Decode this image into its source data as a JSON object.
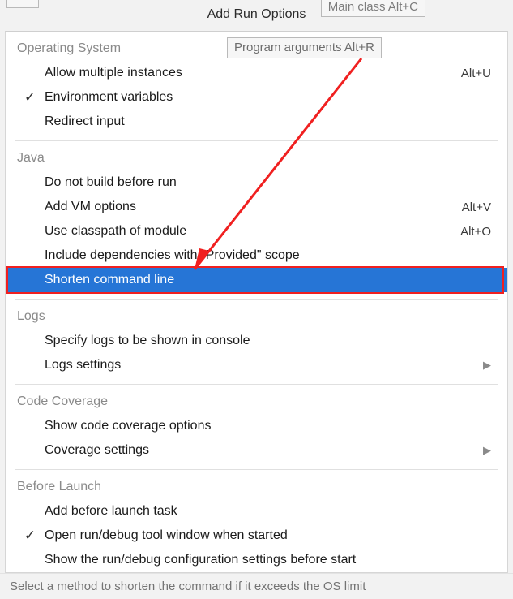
{
  "title": "Add Run Options",
  "tooltips": {
    "main_class": "Main class Alt+C",
    "program_args": "Program arguments Alt+R"
  },
  "sections": {
    "os": {
      "header": "Operating System",
      "items": {
        "allow_multiple": {
          "label": "Allow multiple instances",
          "shortcut": "Alt+U"
        },
        "env_vars": {
          "label": "Environment variables"
        },
        "redirect_input": {
          "label": "Redirect input"
        }
      }
    },
    "java": {
      "header": "Java",
      "items": {
        "no_build": {
          "label": "Do not build before run"
        },
        "vm_options": {
          "label": "Add VM options",
          "shortcut": "Alt+V"
        },
        "classpath": {
          "label": "Use classpath of module",
          "shortcut": "Alt+O"
        },
        "provided": {
          "label": "Include dependencies with \"Provided\" scope"
        },
        "shorten_cli": {
          "label": "Shorten command line"
        }
      }
    },
    "logs": {
      "header": "Logs",
      "items": {
        "specify_logs": {
          "label": "Specify logs to be shown in console"
        },
        "logs_settings": {
          "label": "Logs settings"
        }
      }
    },
    "coverage": {
      "header": "Code Coverage",
      "items": {
        "show_cc": {
          "label": "Show code coverage options"
        },
        "cc_settings": {
          "label": "Coverage settings"
        }
      }
    },
    "before": {
      "header": "Before Launch",
      "items": {
        "add_task": {
          "label": "Add before launch task"
        },
        "open_tool": {
          "label": "Open run/debug tool window when started"
        },
        "show_cfg": {
          "label": "Show the run/debug configuration settings before start"
        }
      }
    }
  },
  "status": "Select a method to shorten the command if it exceeds the OS limit",
  "glyphs": {
    "check": "✓",
    "arrow": "▶"
  }
}
